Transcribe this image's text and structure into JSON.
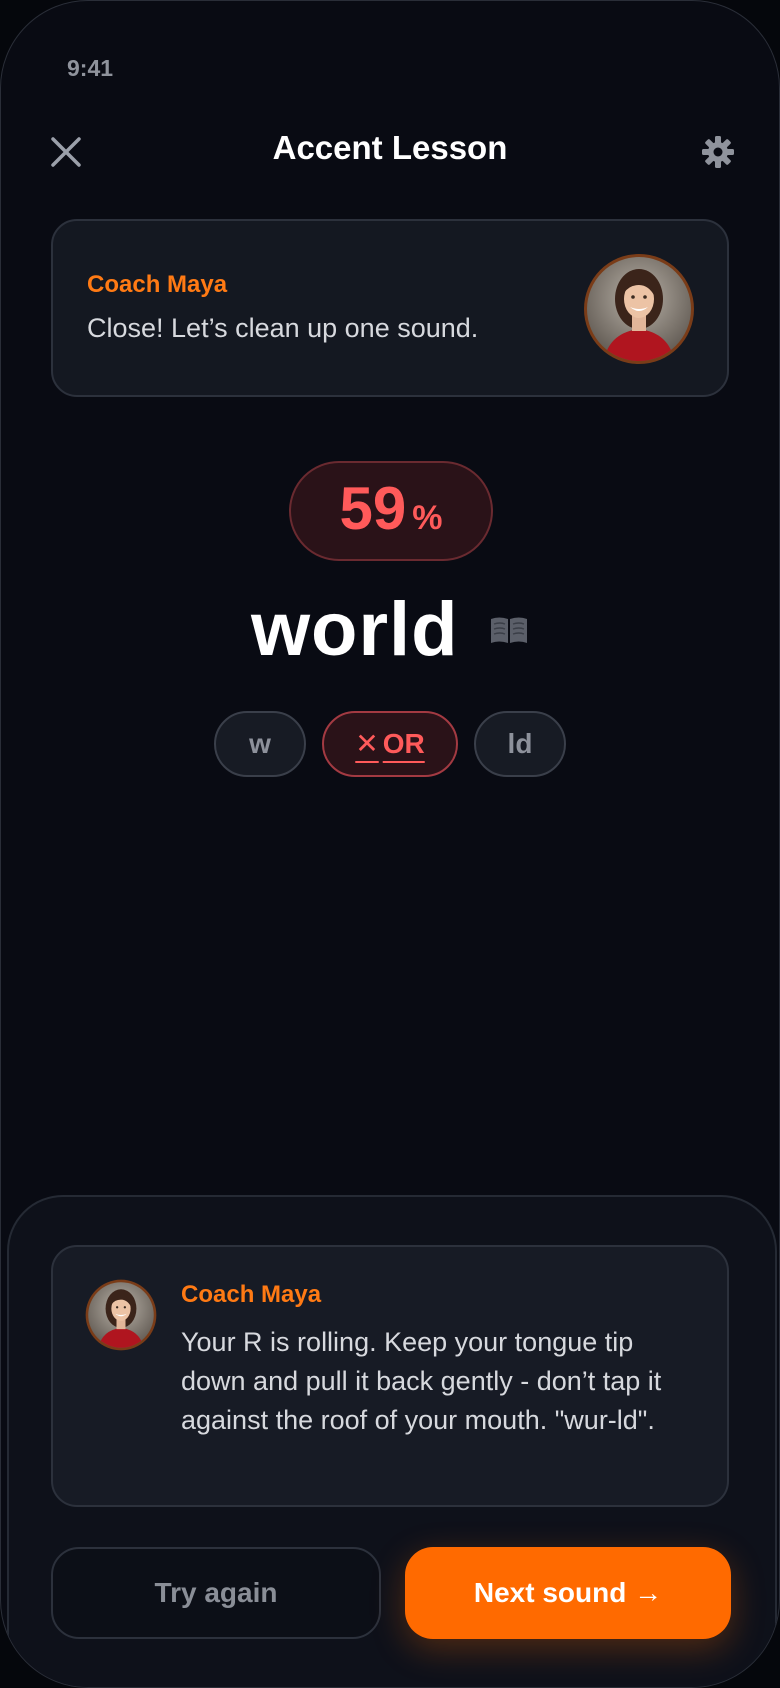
{
  "status_bar": {
    "time": "9:41"
  },
  "header": {
    "title": "Accent Lesson",
    "close_icon": "close-icon",
    "settings_icon": "gear-icon"
  },
  "coach_card": {
    "name": "Coach Maya",
    "message": "Close! Let’s clean up one sound."
  },
  "score": {
    "value": "59",
    "unit": "%"
  },
  "word": {
    "text": "world",
    "icon": "book-icon"
  },
  "phonemes": [
    {
      "label": "w",
      "status": "neutral"
    },
    {
      "mark": "✕",
      "label": "OR",
      "status": "error"
    },
    {
      "label": "ld",
      "status": "neutral"
    }
  ],
  "feedback": {
    "name": "Coach Maya",
    "message": "Your R is rolling. Keep your tongue tip down and pull it back gently - don’t tap it against the roof of your mouth. \"wur-ld\"."
  },
  "actions": {
    "try_again": "Try again",
    "next_sound": "Next sound →"
  },
  "colors": {
    "background": "#090b13",
    "card": "#141821",
    "accent": "#ff6a00",
    "coach_name": "#ff7a14",
    "error": "#ff5a5a"
  }
}
